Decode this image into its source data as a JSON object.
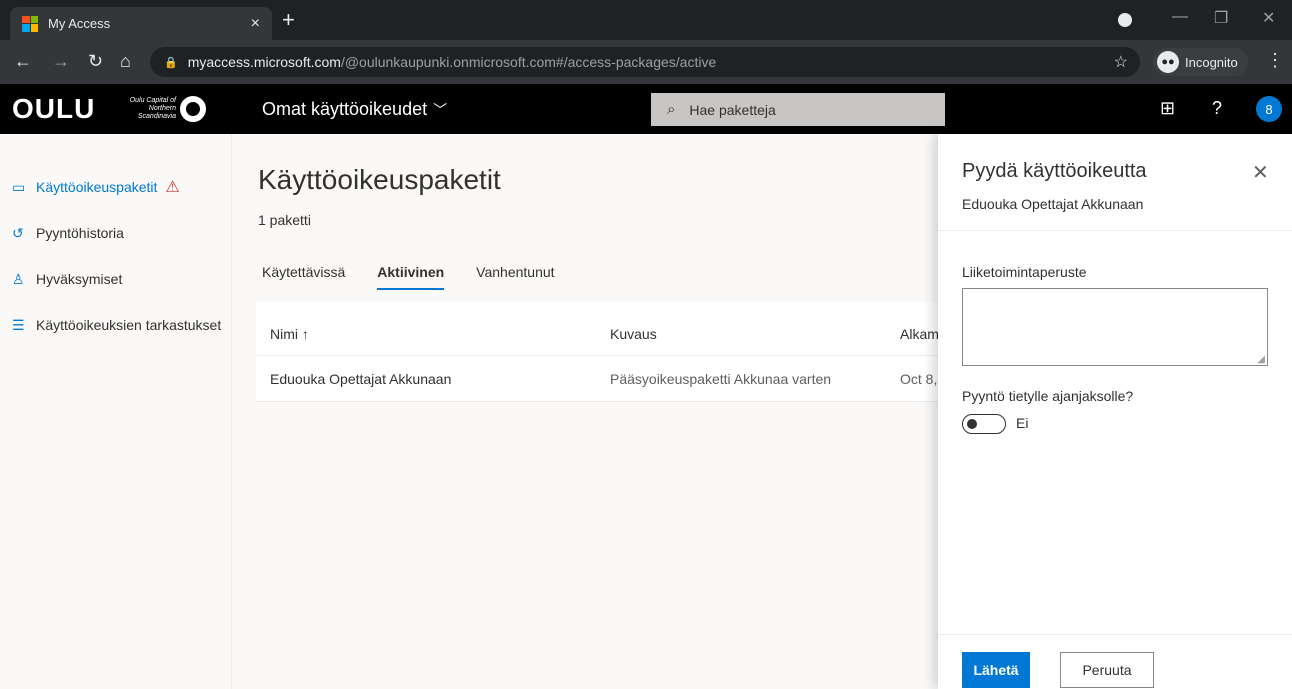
{
  "browser": {
    "tab_title": "My Access",
    "tab_close": "×",
    "new_tab": "+",
    "url_host": "myaccess.microsoft.com",
    "url_path": "/@oulunkaupunki.onmicrosoft.com#/access-packages/active",
    "incognito_label": "Incognito",
    "logo_colors": [
      "#f25022",
      "#7fba00",
      "#00a4ef",
      "#ffb900"
    ]
  },
  "app_header": {
    "brand": "OULU",
    "brand_tagline": "Oulu Capital of Northern Scandinavia",
    "app_name": "Omat käyttöoikeudet",
    "search_placeholder": "Hae paketteja",
    "help": "?",
    "avatar_initial": "8"
  },
  "sidebar": {
    "items": [
      {
        "label": "Käyttöoikeuspaketit",
        "icon": "package-icon",
        "active": true,
        "warning": true
      },
      {
        "label": "Pyyntöhistoria",
        "icon": "history-icon"
      },
      {
        "label": "Hyväksymiset",
        "icon": "person-icon"
      },
      {
        "label": "Käyttöoikeuksien tarkastukset",
        "icon": "checklist-icon"
      }
    ]
  },
  "main": {
    "title": "Käyttöoikeuspaketit",
    "count": "1 paketti",
    "tabs": [
      {
        "label": "Käytettävissä"
      },
      {
        "label": "Aktiivinen",
        "active": true
      },
      {
        "label": "Vanhentunut"
      }
    ],
    "table": {
      "headers": [
        "Nimi ↑",
        "Kuvaus",
        "Alkam"
      ],
      "rows": [
        [
          "Eduouka Opettajat Akkunaan",
          "Pääsyoikeuspaketti Akkunaa varten",
          "Oct 8,"
        ]
      ]
    }
  },
  "panel": {
    "title": "Pyydä käyttöoikeutta",
    "subtitle": "Eduouka Opettajat Akkunaan",
    "justification_label": "Liiketoimintaperuste",
    "timeframe_label": "Pyyntö tietylle ajanjaksolle?",
    "toggle_value": "Ei",
    "submit_label": "Lähetä",
    "cancel_label": "Peruuta"
  }
}
